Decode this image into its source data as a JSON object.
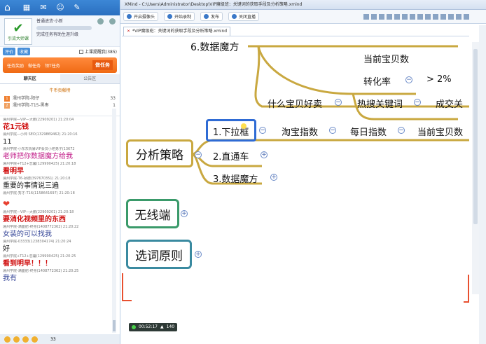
{
  "left_panel": {
    "nav_icons": [
      "home-icon",
      "grid-icon",
      "mail-icon",
      "user-icon",
      "message-icon"
    ],
    "profile": {
      "name_line": "普通进货·小新",
      "level_line": "完成任务有助生涯升级",
      "logo_text": "引流大师课"
    },
    "buttons": {
      "tag1": "评价",
      "tag2": "收藏",
      "checkbox": "上课提醒我(385)"
    },
    "taskbar": {
      "item1": "任务奖励",
      "item2": "做任务",
      "item3": "领T任务",
      "big": "做任务"
    },
    "tabs": {
      "chat": "聊天区",
      "notice": "公告区"
    },
    "rank": {
      "title": "牛币贡献榜",
      "rows": [
        {
          "n": "1",
          "name": "濡州学院-阳仔",
          "val": "33"
        },
        {
          "n": "2",
          "name": "濡州学院-T15-黑枣",
          "val": "1"
        }
      ]
    },
    "chat": [
      {
        "meta": "濡州学院—VIP—大鹏(22909201) 21:20:04",
        "text": "花1元钱",
        "cls": "red"
      },
      {
        "meta": "濡州学院—小帅 SEO(1329869462) 21:20:16",
        "text": "11",
        "cls": "dark"
      },
      {
        "meta": "濡州学院-小东东情暴VIP会员小老弟子(13672",
        "text": "老师把你数据魔方给我",
        "cls": "pink"
      },
      {
        "meta": "濡州学院+T12+恋馨(129990425) 21:20:18",
        "text": "看明早",
        "cls": "red"
      },
      {
        "meta": "濡州学院-T6-祯德(397670351) 21:20:18",
        "text": "重要的事情说三遍",
        "cls": "dark"
      },
      {
        "meta": "濡州学院-秀才-T16(1158641697) 21:20:18",
        "text": "",
        "cls": "heart"
      },
      {
        "meta": "濡州学院—VIP—大鹏(22909201) 21:20:18",
        "text": "要消化视频里的东西",
        "cls": "red"
      },
      {
        "meta": "濡州学院-满面肥-终身(1408772362) 21:20:22",
        "text": "女装的可以找我",
        "cls": "blue"
      },
      {
        "meta": "濡州学院-03333(1238304174) 21:20:24",
        "text": "好",
        "cls": "dark"
      },
      {
        "meta": "濡州学院+T12+恋馨(129990425) 21:20:25",
        "text": "看到明早！！！",
        "cls": "red"
      },
      {
        "meta": "濡州学院-满面肥-终身(1408772362) 21:20:25",
        "text": "我有",
        "cls": "blue"
      }
    ],
    "bottom_count": "33"
  },
  "window": {
    "title": "XMind - C:\\Users\\Administrator\\Desktop\\VIP魔级班：关键词的获取手段及分析策略.xmind",
    "toolbar": {
      "b1": "开启摄像头",
      "b2": "开始录制",
      "b3": "发布",
      "b4": "关闭直播"
    },
    "doc_tab": "*VIP魔级班：关键词的获取手段及分析策略.xmind",
    "status": {
      "time": "00:52:17",
      "count": "140"
    }
  },
  "mindmap": {
    "top_branch": "6.数据魔方",
    "top_children": [
      "当前宝贝数",
      "转化率",
      "> 2%"
    ],
    "row_children": [
      "什么宝贝好卖",
      "热搜关键词",
      "成交关"
    ],
    "main1": "分析策略",
    "sub1": "1.下拉框",
    "sub1_children": [
      "淘宝指数",
      "每日指数",
      "当前宝贝数"
    ],
    "sub2": "2.直通车",
    "sub3": "3.数据魔方",
    "main2": "无线端",
    "main3": "选词原则"
  },
  "colors": {
    "accent": "#2f6bd4",
    "gold_branch": "#c9a840",
    "green_box": "#3a9a6a",
    "teal_box": "#3a8aa0",
    "red_corner": "#e85030"
  }
}
